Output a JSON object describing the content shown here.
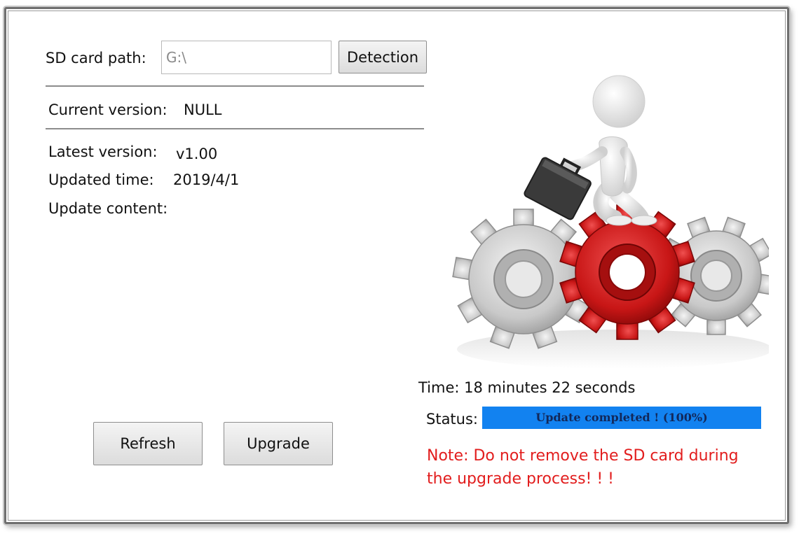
{
  "sd_card": {
    "label": "SD card path:",
    "value": "G:\\",
    "detect_button": "Detection"
  },
  "current": {
    "label": "Current version:",
    "value": "NULL"
  },
  "latest": {
    "label": "Latest version:",
    "value": "v1.00"
  },
  "updated_time": {
    "label": "Updated time:",
    "value": "2019/4/1"
  },
  "update_content": {
    "label": "Update content:"
  },
  "buttons": {
    "refresh": "Refresh",
    "upgrade": "Upgrade"
  },
  "time": {
    "text": "Time: 18 minutes 22 seconds"
  },
  "status": {
    "label": "Status:",
    "progress_text": "Update completed !  (100%)",
    "progress_value": 1.0,
    "bar_color": "#1282f0"
  },
  "note": {
    "line1": "Note: Do not remove the SD card during",
    "line2": "the upgrade process! ! !",
    "color": "#e21d1d"
  },
  "illustration": {
    "icon": "man-on-gears-illustration"
  }
}
